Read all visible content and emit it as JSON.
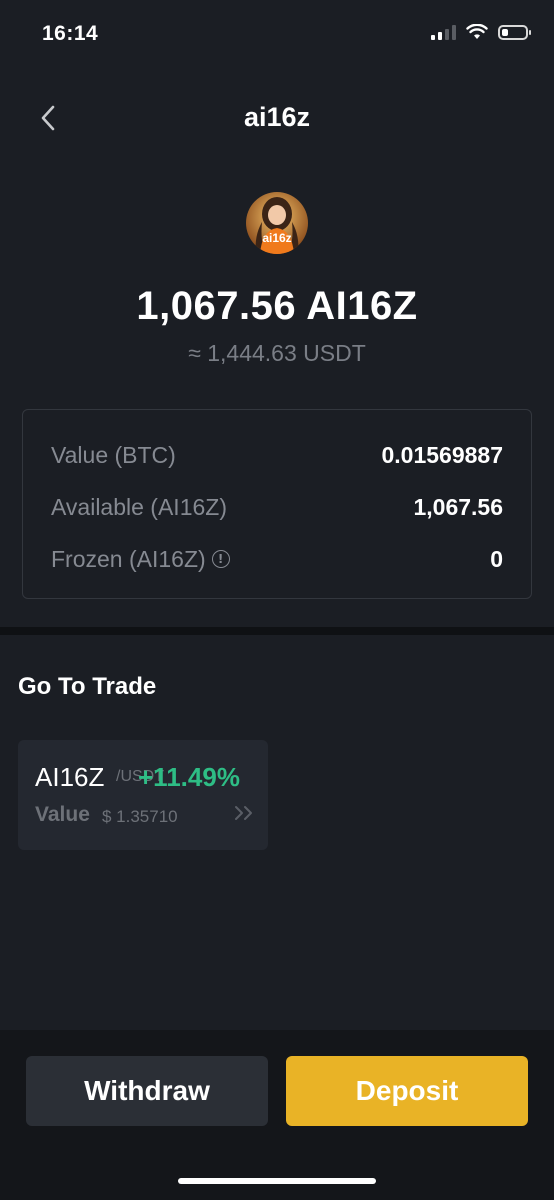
{
  "status_bar": {
    "time": "16:14",
    "icons": [
      "signal-icon",
      "wifi-icon",
      "battery-icon"
    ],
    "battery_level": 0.25
  },
  "nav": {
    "title": "ai16z",
    "back_icon": "chevron-left-icon"
  },
  "token": {
    "avatar_text": "ai16z",
    "amount": "1,067.56 AI16Z",
    "usdt_equivalent": "≈ 1,444.63 USDT"
  },
  "balances": [
    {
      "label": "Value (BTC)",
      "value": "0.01569887"
    },
    {
      "label": "Available (AI16Z)",
      "value": "1,067.56"
    },
    {
      "label": "Frozen (AI16Z)",
      "value": "0",
      "info_icon": "info-icon"
    }
  ],
  "trade_section": {
    "title": "Go To Trade",
    "pair": {
      "base": "AI16Z",
      "quote": "/USDT",
      "change": "+11.49%",
      "value_label": "Value",
      "value": "$ 1.35710"
    }
  },
  "actions": {
    "withdraw_label": "Withdraw",
    "deposit_label": "Deposit"
  },
  "colors": {
    "background": "#1b1e24",
    "positive": "#2ebd85",
    "deposit_button": "#e9b326",
    "muted_text": "#868a92"
  }
}
